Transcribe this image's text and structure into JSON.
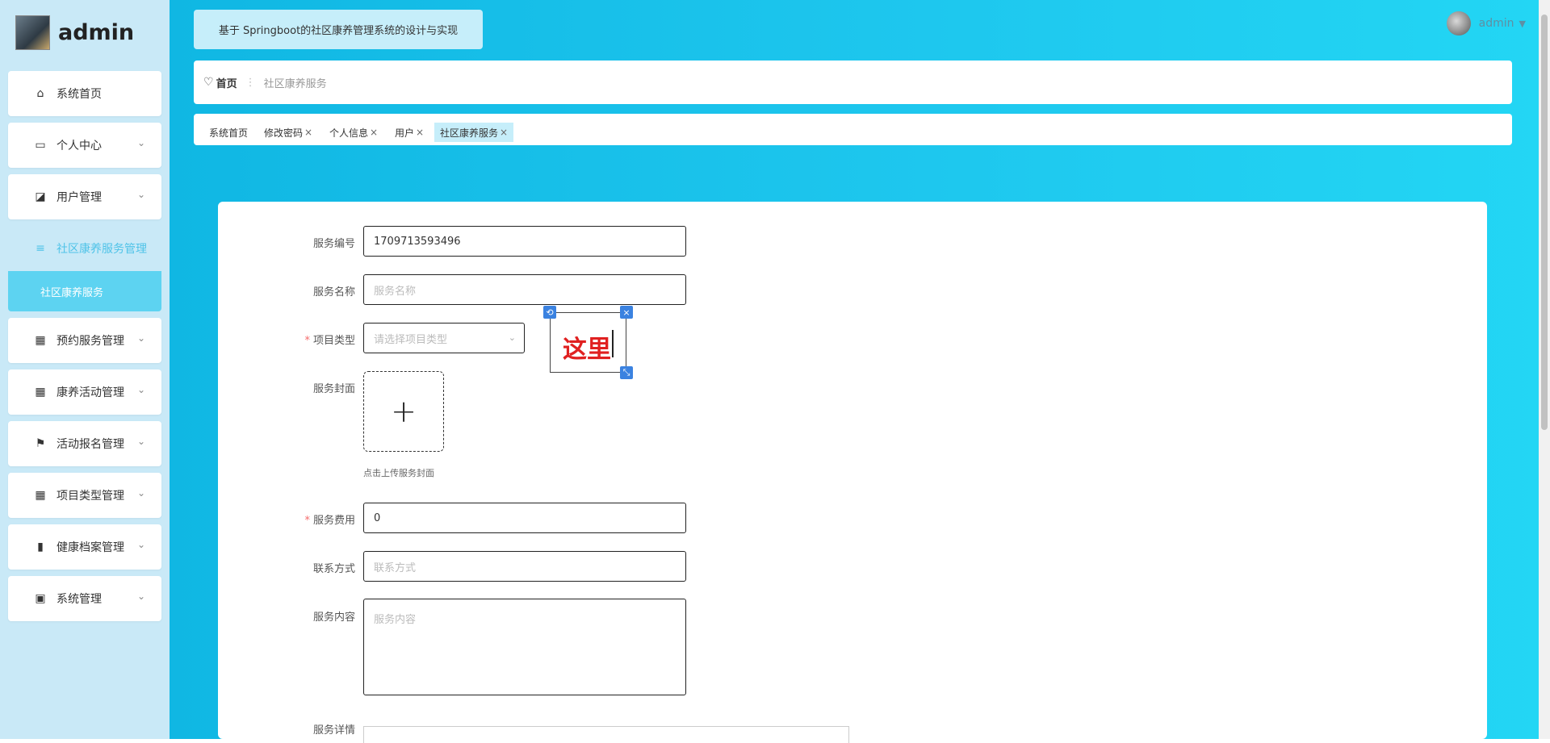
{
  "brand": {
    "name": "admin"
  },
  "sidebar": {
    "items": [
      {
        "label": "系统首页",
        "icon": "home-icon",
        "glyph": "⌂"
      },
      {
        "label": "个人中心",
        "icon": "calendar-icon",
        "glyph": "▭"
      },
      {
        "label": "用户管理",
        "icon": "chart-icon",
        "glyph": "◪"
      },
      {
        "label": "社区康养服务管理",
        "icon": "sliders-icon",
        "glyph": "≡"
      },
      {
        "label": "预约服务管理",
        "icon": "grid-icon",
        "glyph": "▦"
      },
      {
        "label": "康养活动管理",
        "icon": "grid-icon",
        "glyph": "▦"
      },
      {
        "label": "活动报名管理",
        "icon": "flag-icon",
        "glyph": "⚑"
      },
      {
        "label": "项目类型管理",
        "icon": "grid-icon",
        "glyph": "▦"
      },
      {
        "label": "健康档案管理",
        "icon": "book-icon",
        "glyph": "▮"
      },
      {
        "label": "系统管理",
        "icon": "clipboard-icon",
        "glyph": "▣"
      }
    ],
    "submenu_label": "社区康养服务"
  },
  "header": {
    "title": "基于 Springboot的社区康养管理系统的设计与实现",
    "user": "admin",
    "caret": "▼"
  },
  "breadcrumb": {
    "heart": "♡",
    "home": "首页",
    "sep": "⋮",
    "current": "社区康养服务"
  },
  "tags": [
    {
      "label": "系统首页",
      "close": ""
    },
    {
      "label": "修改密码",
      "close": "×"
    },
    {
      "label": "个人信息",
      "close": "×"
    },
    {
      "label": "用户",
      "close": "×"
    },
    {
      "label": "社区康养服务",
      "close": "×"
    }
  ],
  "form": {
    "service_no": {
      "label": "服务编号",
      "value": "1709713593496"
    },
    "service_name": {
      "label": "服务名称",
      "placeholder": "服务名称"
    },
    "project_type": {
      "label": "项目类型",
      "required": "*",
      "placeholder": "请选择项目类型"
    },
    "cover": {
      "label": "服务封面",
      "plus": "+",
      "hint": "点击上传服务封面"
    },
    "fee": {
      "label": "服务费用",
      "required": "*",
      "value": "0"
    },
    "contact": {
      "label": "联系方式",
      "placeholder": "联系方式"
    },
    "content": {
      "label": "服务内容",
      "placeholder": "服务内容"
    },
    "detail": {
      "label": "服务详情"
    }
  },
  "annotation": {
    "text": "这里",
    "rotate": "⟲",
    "close": "×",
    "resize": "⤡"
  }
}
